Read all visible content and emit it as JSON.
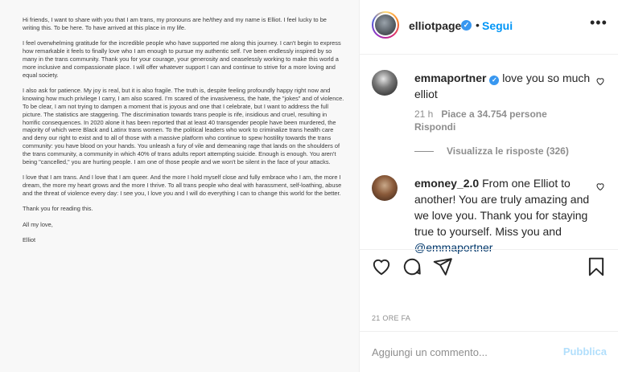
{
  "letter": {
    "paragraphs": [
      "Hi friends, I want to share with you that I am trans, my pronouns are he/they and my name is Elliot. I feel lucky to be writing this. To be here. To have arrived at this place in my life.",
      "I feel overwhelming gratitude for the incredible people who have supported me along this journey. I can't begin to express how remarkable it feels to finally love who I am enough to pursue my authentic self. I've been endlessly inspired by so many in the trans community. Thank you for your courage, your generosity and ceaselessly working to make this world a more inclusive and compassionate place. I will offer whatever support I can and continue to strive for a more loving and equal society.",
      "I also ask for patience. My joy is real, but it is also fragile. The truth is, despite feeling profoundly happy right now and knowing how much privilege I carry, I am also scared. I'm scared of the invasiveness, the hate, the \"jokes\" and of violence. To be clear, I am not trying to dampen a moment that is joyous and one that I celebrate, but I want to address the full picture. The statistics are staggering. The discrimination towards trans people is rife, insidious and cruel, resulting in horrific consequences. In 2020 alone it has been reported that at least 40 transgender people have been murdered, the majority of which were Black and Latinx trans women. To the political leaders who work to criminalize trans health care and deny our right to exist and to all of those with a massive platform who continue to spew hostility towards the trans community: you have blood on your hands. You unleash a fury of vile and demeaning rage that lands on the shoulders of the trans community, a community in which 40% of trans adults report attempting suicide. Enough is enough. You aren't being \"cancelled,\" you are hurting people. I am one of those people and we won't be silent in the face of your attacks.",
      "I love that I am trans. And I love that I am queer. And the more I hold myself close and fully embrace who I am, the more I dream, the more my heart grows and the more I thrive. To all trans people who deal with harassment, self-loathing, abuse and the threat of violence every day: I see you, I love you and I will do everything I can to change this world for the better.",
      "Thank you for reading this.",
      "All my love,",
      "Elliot"
    ]
  },
  "header": {
    "username": "elliotpage",
    "separator": "•",
    "follow_label": "Segui",
    "more_label": "•••",
    "verified_glyph": "✓"
  },
  "comments": [
    {
      "username": "emmaportner",
      "verified": true,
      "text": "love you so much elliot",
      "time": "21 h",
      "likes": "Piace a 34.754 persone",
      "reply_label": "Rispondi",
      "view_replies": "Visualizza le risposte (326)"
    },
    {
      "username": "emoney_2.0",
      "text": "From one Elliot to another! You are truly amazing and we love you. Thank you for staying true to yourself. Miss you and",
      "mention": "@emmaportner"
    }
  ],
  "icons": {
    "heart": "heart-icon",
    "comment": "comment-icon",
    "share": "share-icon",
    "save": "bookmark-icon"
  },
  "time_ago": "21 ORE FA",
  "add_comment": {
    "placeholder": "Aggiungi un commento...",
    "publish_label": "Pubblica"
  },
  "colors": {
    "follow": "#0095f6",
    "verified": "#3897f0",
    "publish_disabled": "#b2dffc",
    "mention": "#00376b"
  }
}
